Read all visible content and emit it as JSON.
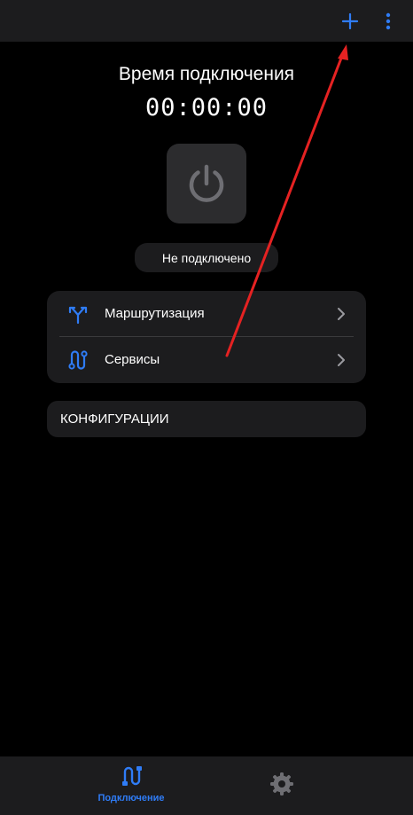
{
  "colors": {
    "accent": "#2f7cf6",
    "background": "#000000",
    "surface": "#1c1c1e",
    "power_surface": "#2c2c2e",
    "power_icon": "#6e6e73",
    "inactive_icon": "#6e6e73",
    "annotation": "#e52222"
  },
  "topbar": {
    "add_icon": "plus-icon",
    "menu_icon": "more-vertical-icon"
  },
  "connection": {
    "title": "Время подключения",
    "timer": "00:00:00",
    "power_icon": "power-icon",
    "status": "Не подключено"
  },
  "menu": {
    "items": [
      {
        "label": "Маршрутизация",
        "icon": "routing-split-icon"
      },
      {
        "label": "Сервисы",
        "icon": "services-icon"
      }
    ]
  },
  "configs": {
    "label": "КОНФИГУРАЦИИ"
  },
  "bottom_nav": {
    "items": [
      {
        "label": "Подключение",
        "icon": "connection-icon",
        "active": true
      },
      {
        "label": "",
        "icon": "gear-icon",
        "active": false
      }
    ]
  }
}
